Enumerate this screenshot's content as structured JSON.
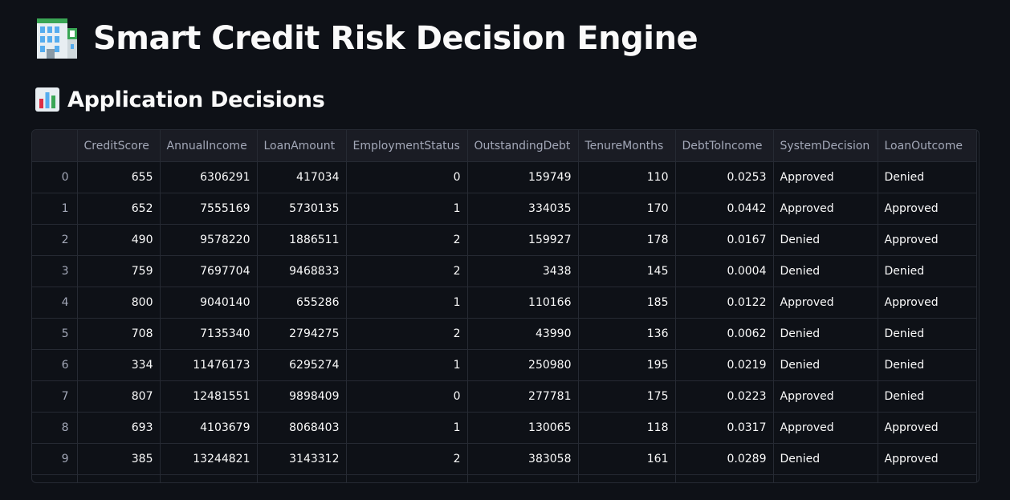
{
  "header": {
    "title": "Smart Credit Risk Decision Engine",
    "title_icon": "office-building-icon"
  },
  "section": {
    "title": "Application Decisions",
    "icon": "bar-chart-icon"
  },
  "table": {
    "columns": [
      "",
      "CreditScore",
      "AnnualIncome",
      "LoanAmount",
      "EmploymentStatus",
      "OutstandingDebt",
      "TenureMonths",
      "DebtToIncome",
      "SystemDecision",
      "LoanOutcome"
    ],
    "rows": [
      [
        "0",
        "655",
        "6306291",
        "417034",
        "0",
        "159749",
        "110",
        "0.0253",
        "Approved",
        "Denied"
      ],
      [
        "1",
        "652",
        "7555169",
        "5730135",
        "1",
        "334035",
        "170",
        "0.0442",
        "Approved",
        "Approved"
      ],
      [
        "2",
        "490",
        "9578220",
        "1886511",
        "2",
        "159927",
        "178",
        "0.0167",
        "Denied",
        "Approved"
      ],
      [
        "3",
        "759",
        "7697704",
        "9468833",
        "2",
        "3438",
        "145",
        "0.0004",
        "Denied",
        "Denied"
      ],
      [
        "4",
        "800",
        "9040140",
        "655286",
        "1",
        "110166",
        "185",
        "0.0122",
        "Approved",
        "Approved"
      ],
      [
        "5",
        "708",
        "7135340",
        "2794275",
        "2",
        "43990",
        "136",
        "0.0062",
        "Denied",
        "Denied"
      ],
      [
        "6",
        "334",
        "11476173",
        "6295274",
        "1",
        "250980",
        "195",
        "0.0219",
        "Denied",
        "Denied"
      ],
      [
        "7",
        "807",
        "12481551",
        "9898409",
        "0",
        "277781",
        "175",
        "0.0223",
        "Approved",
        "Denied"
      ],
      [
        "8",
        "693",
        "4103679",
        "8068403",
        "1",
        "130065",
        "118",
        "0.0317",
        "Approved",
        "Approved"
      ],
      [
        "9",
        "385",
        "13244821",
        "3143312",
        "2",
        "383058",
        "161",
        "0.0289",
        "Denied",
        "Approved"
      ]
    ]
  },
  "colors": {
    "background": "#0e1117",
    "header_bg": "#1a1c24",
    "border": "#262a33",
    "text": "#fafafa",
    "muted": "#a3a8b8"
  }
}
